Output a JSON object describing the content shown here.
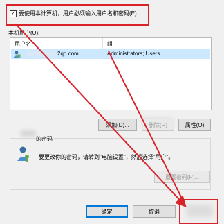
{
  "require_login": {
    "checked": true,
    "check_glyph": "✓",
    "label": "要使用本计算机，用户必须输入用户名和密码(E)"
  },
  "users_section": {
    "label": "本机用户(U):"
  },
  "table": {
    "columns": [
      "用户名",
      "组"
    ],
    "rows": [
      {
        "user_domain": "2qq.com",
        "group": "Administrators; Users"
      }
    ]
  },
  "buttons": {
    "add": "添加(D)...",
    "delete": "删除(R)",
    "properties": "属性(O)",
    "reset_password": "重置密码(P)...",
    "ok": "确定",
    "cancel": "取消"
  },
  "password_section": {
    "title": "的密码",
    "text": "要更改你的密码，请转到\"电脑设置\"，然后选择\"用户\"。"
  },
  "colors": {
    "annotation_red": "#d8232a",
    "selection": "#cce8ff"
  },
  "icons": {
    "user_row": "user-icon",
    "password": "user-key-icon"
  }
}
